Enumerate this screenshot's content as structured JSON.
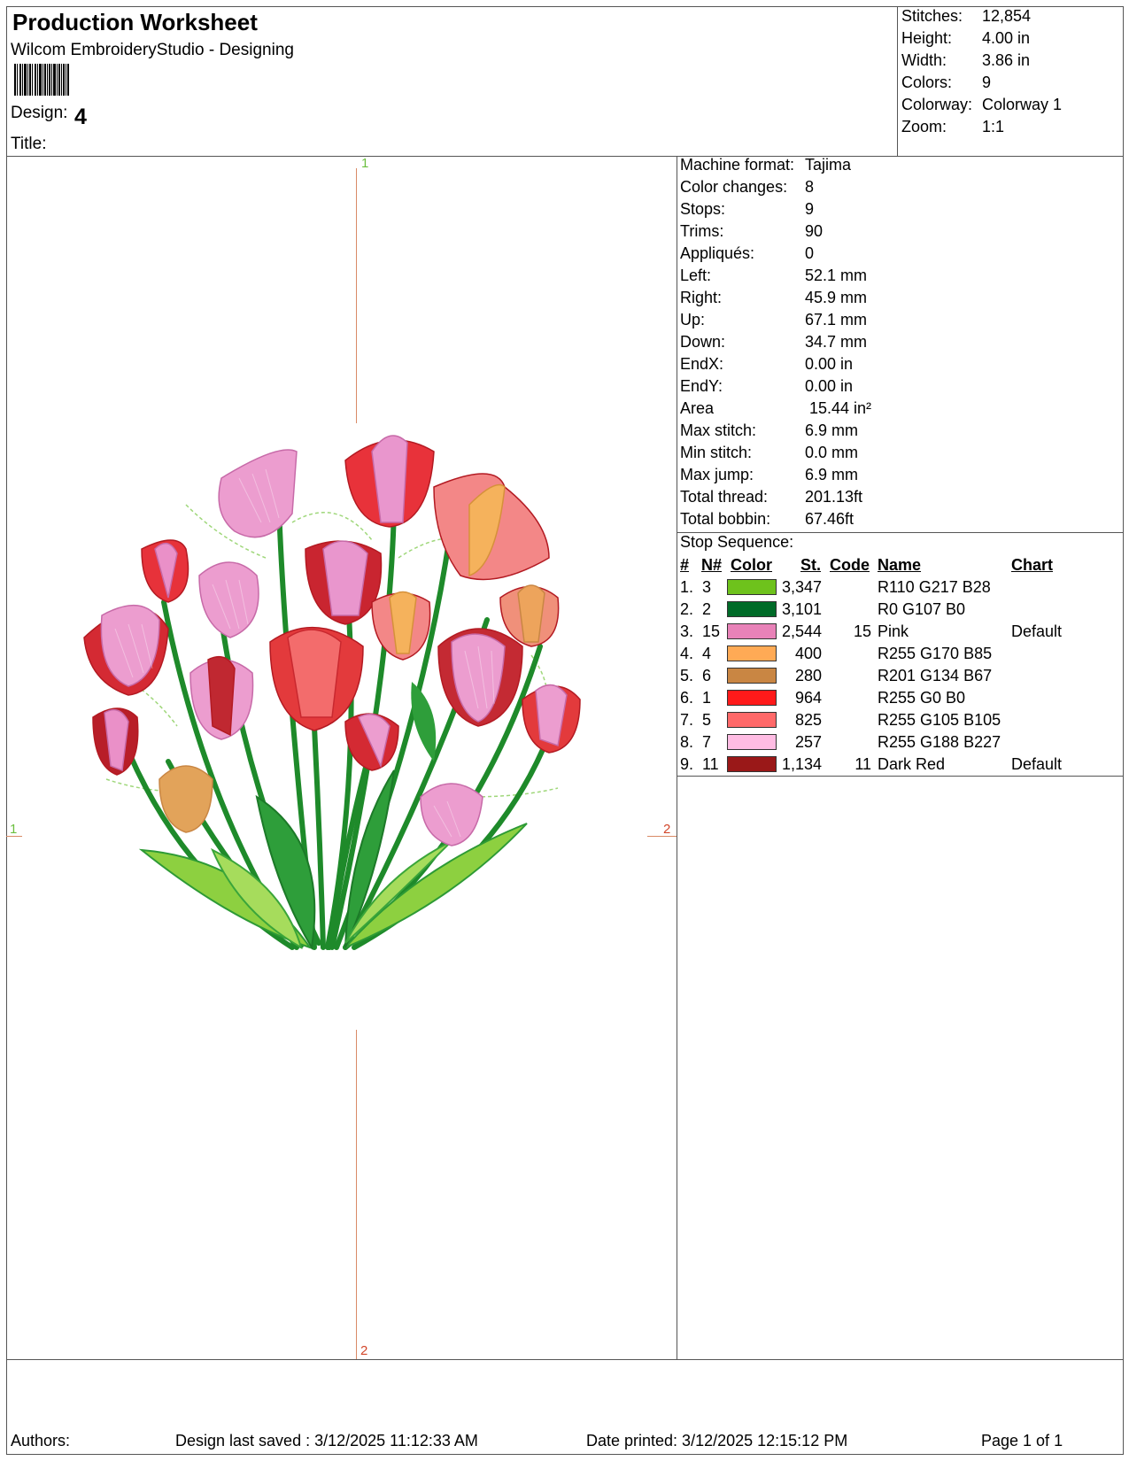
{
  "header": {
    "title": "Production Worksheet",
    "subtitle": "Wilcom EmbroideryStudio - Designing",
    "design_label": "Design:",
    "design_value": "4",
    "title_label": "Title:",
    "title_value": ""
  },
  "summary": [
    {
      "label": "Stitches:",
      "value": "12,854"
    },
    {
      "label": "Height:",
      "value": "4.00 in"
    },
    {
      "label": "Width:",
      "value": "3.86 in"
    },
    {
      "label": "Colors:",
      "value": "9"
    },
    {
      "label": "Colorway:",
      "value": "Colorway 1"
    },
    {
      "label": "Zoom:",
      "value": "1:1"
    }
  ],
  "details": [
    {
      "label": "Machine format:",
      "value": "Tajima"
    },
    {
      "label": "Color changes:",
      "value": "8"
    },
    {
      "label": "Stops:",
      "value": "9"
    },
    {
      "label": "Trims:",
      "value": "90"
    },
    {
      "label": "Appliqués:",
      "value": "0"
    },
    {
      "label": "Left:",
      "value": "52.1 mm"
    },
    {
      "label": "Right:",
      "value": "45.9 mm"
    },
    {
      "label": "Up:",
      "value": "67.1 mm"
    },
    {
      "label": "Down:",
      "value": "34.7 mm"
    },
    {
      "label": "EndX:",
      "value": "0.00 in"
    },
    {
      "label": "EndY:",
      "value": "0.00 in"
    },
    {
      "label": "Area",
      "value": " 15.44 in²"
    },
    {
      "label": "Max stitch:",
      "value": "6.9 mm"
    },
    {
      "label": "Min stitch:",
      "value": "0.0 mm"
    },
    {
      "label": "Max jump:",
      "value": "6.9 mm"
    },
    {
      "label": "Total thread:",
      "value": "201.13ft"
    },
    {
      "label": "Total bobbin:",
      "value": "67.46ft"
    }
  ],
  "stop_sequence": {
    "title": "Stop Sequence:",
    "headers": {
      "num": "#",
      "n": "N#",
      "color": "Color",
      "st": "St.",
      "code": "Code",
      "name": "Name",
      "chart": "Chart"
    },
    "rows": [
      {
        "num": "1.",
        "n": "3",
        "color": "#6ec21c",
        "st": "3,347",
        "code": "",
        "name": "R110 G217 B28",
        "chart": ""
      },
      {
        "num": "2.",
        "n": "2",
        "color": "#006b28",
        "st": "3,101",
        "code": "",
        "name": "R0 G107 B0",
        "chart": ""
      },
      {
        "num": "3.",
        "n": "15",
        "color": "#e882b8",
        "st": "2,544",
        "code": "15",
        "name": "Pink",
        "chart": "Default"
      },
      {
        "num": "4.",
        "n": "4",
        "color": "#ffaa55",
        "st": "400",
        "code": "",
        "name": "R255 G170 B85",
        "chart": ""
      },
      {
        "num": "5.",
        "n": "6",
        "color": "#c98643",
        "st": "280",
        "code": "",
        "name": "R201 G134 B67",
        "chart": ""
      },
      {
        "num": "6.",
        "n": "1",
        "color": "#ff1a1a",
        "st": "964",
        "code": "",
        "name": "R255 G0 B0",
        "chart": ""
      },
      {
        "num": "7.",
        "n": "5",
        "color": "#ff6969",
        "st": "825",
        "code": "",
        "name": "R255 G105 B105",
        "chart": ""
      },
      {
        "num": "8.",
        "n": "7",
        "color": "#ffbce3",
        "st": "257",
        "code": "",
        "name": "R255 G188 B227",
        "chart": ""
      },
      {
        "num": "9.",
        "n": "11",
        "color": "#9a1818",
        "st": "1,134",
        "code": "11",
        "name": "Dark Red",
        "chart": "Default"
      }
    ]
  },
  "guides": {
    "top": "1",
    "bottom": "2",
    "left": "1",
    "right": "2"
  },
  "footer": {
    "authors": "Authors:",
    "saved": "Design last saved : 3/12/2025 11:12:33 AM",
    "printed": "Date printed: 3/12/2025 12:15:12 PM",
    "page": "Page 1 of 1"
  }
}
